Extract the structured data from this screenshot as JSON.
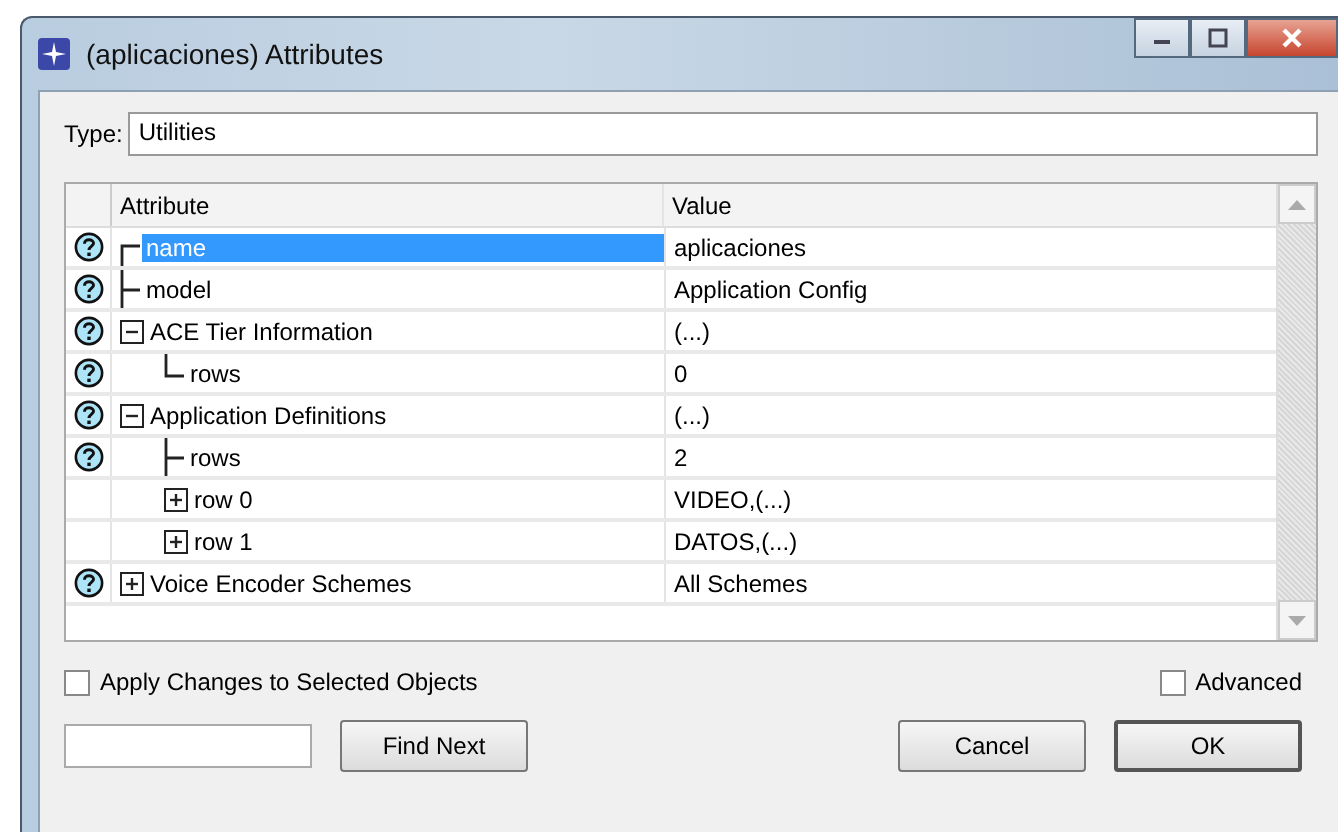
{
  "window": {
    "title": "(aplicaciones) Attributes"
  },
  "type_field": {
    "label": "Type:",
    "value": "Utilities"
  },
  "table": {
    "columns": [
      "Attribute",
      "Value"
    ],
    "rows": [
      {
        "name": "name",
        "value": "aplicaciones",
        "help": true,
        "selected": true
      },
      {
        "name": "model",
        "value": "Application Config",
        "help": true,
        "selected": false
      },
      {
        "name": "ACE Tier Information",
        "value": "(...)",
        "help": true,
        "selected": false,
        "expanded": true,
        "children": [
          {
            "name": "rows",
            "value": "0",
            "help": true,
            "selected": false
          }
        ]
      },
      {
        "name": "Application Definitions",
        "value": "(...)",
        "help": true,
        "selected": false,
        "expanded": true,
        "children": [
          {
            "name": "rows",
            "value": "2",
            "help": true,
            "selected": false
          },
          {
            "name": "row 0",
            "value": "VIDEO,(...)",
            "help": false,
            "selected": false,
            "expanded": false
          },
          {
            "name": "row 1",
            "value": "DATOS,(...)",
            "help": false,
            "selected": false,
            "expanded": false
          }
        ]
      },
      {
        "name": "Voice Encoder Schemes",
        "value": "All Schemes",
        "help": true,
        "selected": false,
        "expanded": false
      }
    ]
  },
  "apply_checkbox": {
    "label": "Apply Changes to Selected Objects",
    "checked": false
  },
  "advanced_checkbox": {
    "label": "Advanced",
    "checked": false
  },
  "buttons": [
    {
      "label": "Find Next",
      "kind": "find"
    },
    {
      "label": "Cancel",
      "kind": "cancel"
    },
    {
      "label": "OK",
      "kind": "ok"
    }
  ]
}
